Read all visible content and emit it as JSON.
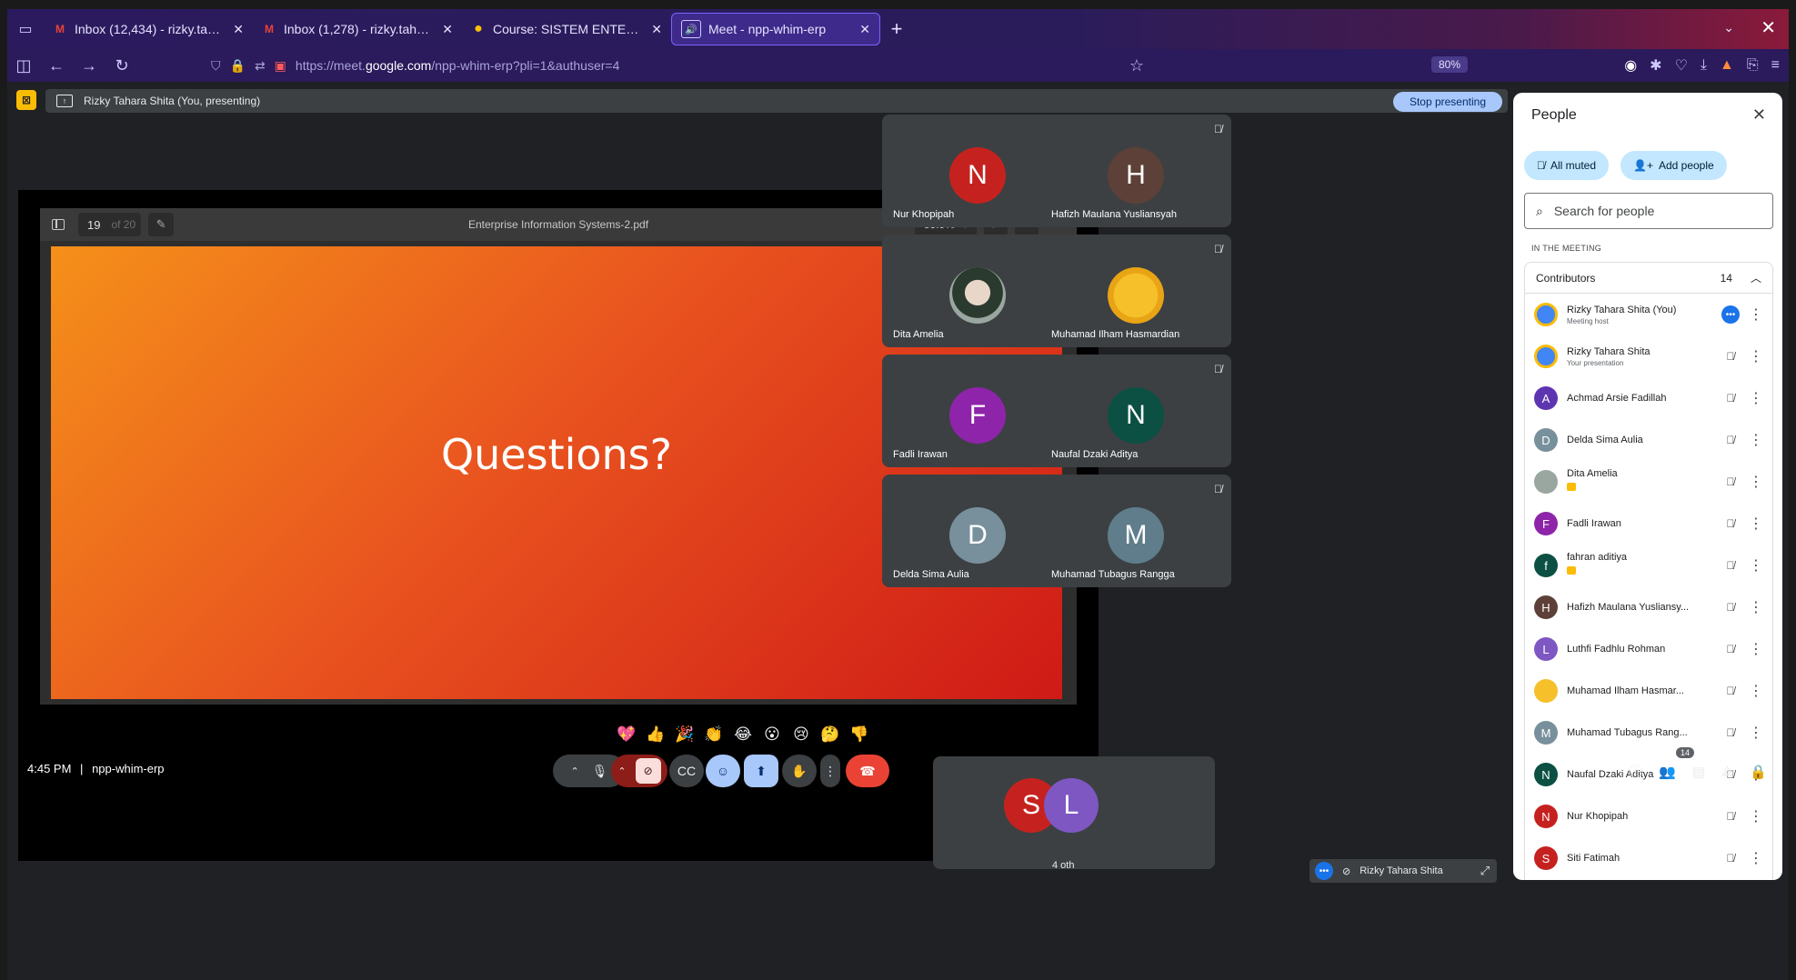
{
  "browser": {
    "tabs": [
      {
        "icon": "gmail-icon",
        "title": "Inbox (12,434) - rizky.tahara",
        "active": false
      },
      {
        "icon": "gmail-icon",
        "title": "Inbox (1,278) - rizky.taharash",
        "active": false
      },
      {
        "icon": "course-icon",
        "title": "Course: SISTEM ENTERPRISE",
        "active": false
      },
      {
        "icon": "meet-icon",
        "title": "Meet - npp-whim-erp",
        "active": true
      }
    ],
    "url_prefix": "https://meet.",
    "url_host": "google.com",
    "url_path": "/npp-whim-erp?pli=1&authuser=4",
    "zoom": "80%"
  },
  "meet": {
    "presenting_label": "Rizky Tahara Shita (You, presenting)",
    "stop_presenting": "Stop presenting",
    "pdf": {
      "page": "19",
      "page_of": "of 20",
      "filename": "Enterprise Information Systems-2.pdf",
      "zoom": "55.9%"
    },
    "slide_text": "Questions?",
    "tiles": [
      {
        "initial": "N",
        "name": "Nur Khopipah",
        "color": "#c5221f"
      },
      {
        "initial": "H",
        "name": "Hafizh Maulana Yusliansyah",
        "color": "#5d4037"
      },
      {
        "initial": "",
        "name": "Dita Amelia",
        "color": "#9aa6a0"
      },
      {
        "initial": "",
        "name": "Muhamad Ilham Hasmardian",
        "color": "#f5c02a"
      },
      {
        "initial": "F",
        "name": "Fadli Irawan",
        "color": "#8e24aa"
      },
      {
        "initial": "N",
        "name": "Naufal Dzaki Aditya",
        "color": "#0b5043"
      },
      {
        "initial": "D",
        "name": "Delda Sima Aulia",
        "color": "#78909c"
      },
      {
        "initial": "M",
        "name": "Muhamad Tubagus Rangga",
        "color": "#607d8b"
      }
    ],
    "others": {
      "initial1": "S",
      "initial2": "L",
      "label": "4 oth"
    },
    "self_chip": "Rizky Tahara Shita",
    "reactions": [
      "💖",
      "👍",
      "🎉",
      "👏",
      "😂",
      "😮",
      "😢",
      "🤔",
      "👎"
    ],
    "time": "4:45 PM",
    "separator": "|",
    "meeting_code": "npp-whim-erp",
    "people_badge": "14"
  },
  "people_panel": {
    "title": "People",
    "all_muted": "All muted",
    "add_people": "Add people",
    "search_placeholder": "Search for people",
    "in_meeting": "IN THE MEETING",
    "contributors_label": "Contributors",
    "contributors_count": "14",
    "people": [
      {
        "initial": "",
        "name": "Rizky Tahara Shita (You)",
        "sub": "Meeting host",
        "color": "#4285f4"
      },
      {
        "initial": "",
        "name": "Rizky Tahara Shita",
        "sub": "Your presentation",
        "color": "#4285f4"
      },
      {
        "initial": "A",
        "name": "Achmad Arsie Fadillah",
        "sub": "",
        "color": "#5e35b1"
      },
      {
        "initial": "D",
        "name": "Delda Sima Aulia",
        "sub": "",
        "color": "#78909c"
      },
      {
        "initial": "",
        "name": "Dita Amelia",
        "sub": "",
        "color": "#9aa6a0"
      },
      {
        "initial": "F",
        "name": "Fadli Irawan",
        "sub": "",
        "color": "#8e24aa"
      },
      {
        "initial": "f",
        "name": "fahran aditiya",
        "sub": "",
        "color": "#0b5043"
      },
      {
        "initial": "H",
        "name": "Hafizh Maulana Yusliansy...",
        "sub": "",
        "color": "#5d4037"
      },
      {
        "initial": "L",
        "name": "Luthfi Fadhlu Rohman",
        "sub": "",
        "color": "#7e57c2"
      },
      {
        "initial": "",
        "name": "Muhamad Ilham Hasmar...",
        "sub": "",
        "color": "#f5c02a"
      },
      {
        "initial": "M",
        "name": "Muhamad Tubagus Rang...",
        "sub": "",
        "color": "#78909c"
      },
      {
        "initial": "N",
        "name": "Naufal Dzaki Aditya",
        "sub": "",
        "color": "#0b5043"
      },
      {
        "initial": "N",
        "name": "Nur Khopipah",
        "sub": "",
        "color": "#c5221f"
      },
      {
        "initial": "S",
        "name": "Siti Fatimah",
        "sub": "",
        "color": "#c5221f"
      }
    ]
  }
}
